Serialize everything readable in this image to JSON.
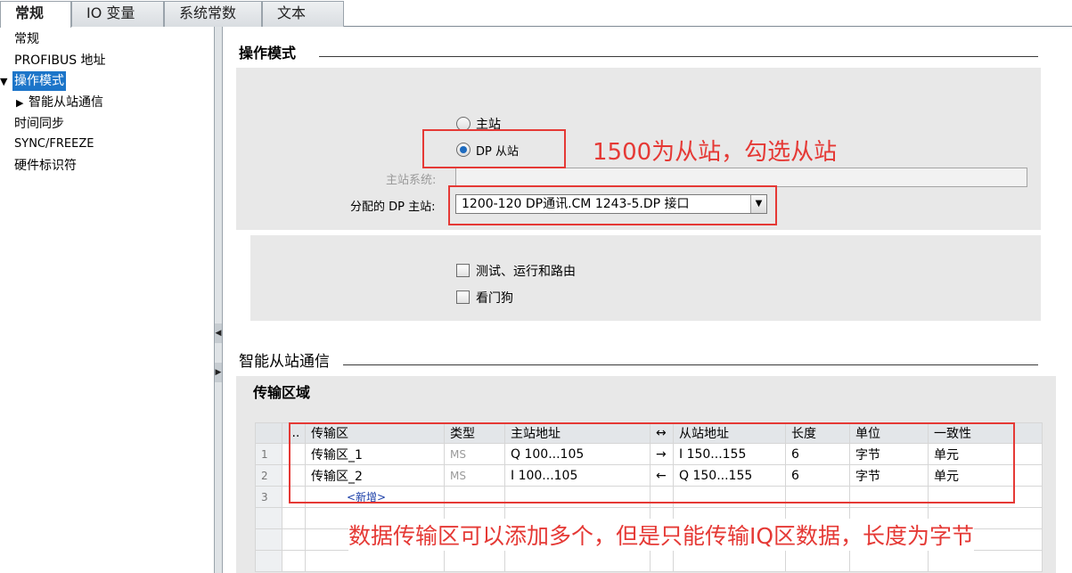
{
  "tabs": [
    "常规",
    "IO 变量",
    "系统常数",
    "文本"
  ],
  "sidebar": {
    "items": [
      "常规",
      "PROFIBUS 地址",
      "操作模式",
      "智能从站通信",
      "时间同步",
      "SYNC/FREEZE",
      "硬件标识符"
    ]
  },
  "operating_mode": {
    "title": "操作模式",
    "radio_master": "主站",
    "radio_dp_slave": "DP 从站",
    "selected_radio": "DP 从站",
    "master_system_label": "主站系统:",
    "master_system_value": "",
    "assigned_master_label": "分配的 DP 主站:",
    "assigned_master_value": "1200-120 DP通讯.CM 1243-5.DP 接口",
    "check_test": "测试、运行和路由",
    "check_watchdog": "看门狗",
    "check_test_checked": false,
    "check_watchdog_checked": false
  },
  "i_slave": {
    "title": "智能从站通信",
    "transfer_title": "传输区域",
    "columns": [
      "...",
      "传输区",
      "类型",
      "主站地址",
      "↔",
      "从站地址",
      "长度",
      "单位",
      "一致性"
    ],
    "rows": [
      {
        "num": "1",
        "name": "传输区_1",
        "type": "MS",
        "master": "Q 100...105",
        "dir": "→",
        "slave": "I 150...155",
        "length": "6",
        "unit": "字节",
        "consistency": "单元"
      },
      {
        "num": "2",
        "name": "传输区_2",
        "type": "MS",
        "master": "I 100...105",
        "dir": "←",
        "slave": "Q 150...155",
        "length": "6",
        "unit": "字节",
        "consistency": "单元"
      }
    ],
    "new_row_num": "3",
    "new_row_label": "<新增>"
  },
  "annotations": {
    "note_slave": "1500为从站，勾选从站",
    "note_transfer": "数据传输区可以添加多个，但是只能传输IQ区数据，长度为字节",
    "color": "#e53935"
  },
  "icons": {
    "splitter_left": "chevron-left-icon",
    "splitter_right": "chevron-right-icon",
    "dropdown": "chevron-down-icon",
    "tree_expanded": "triangle-down-icon",
    "tree_collapsed": "triangle-right-icon"
  }
}
